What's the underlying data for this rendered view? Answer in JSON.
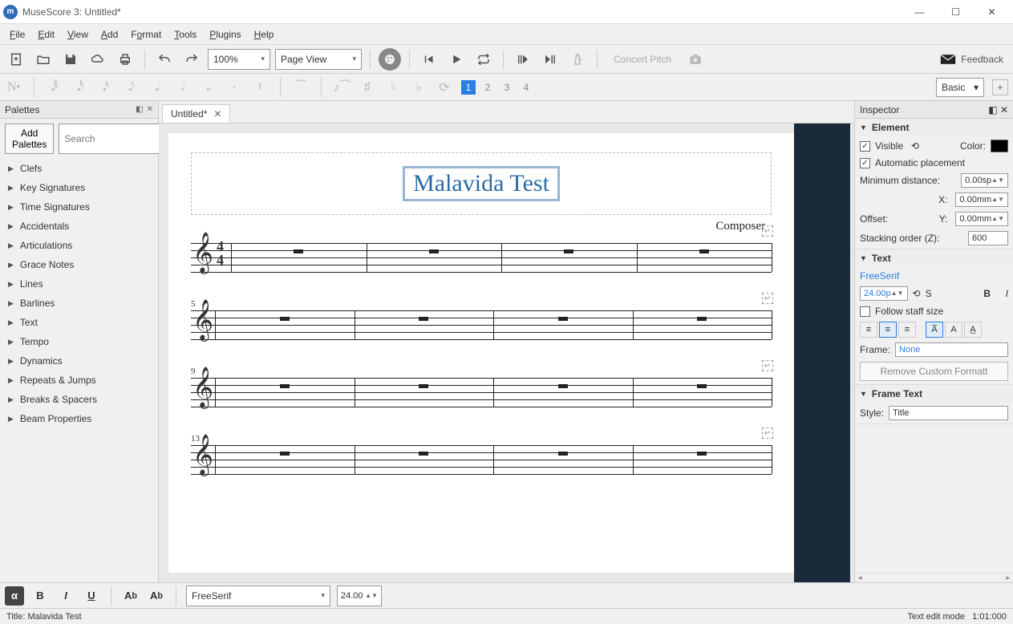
{
  "window": {
    "title": "MuseScore 3: Untitled*"
  },
  "menu": [
    "File",
    "Edit",
    "View",
    "Add",
    "Format",
    "Tools",
    "Plugins",
    "Help"
  ],
  "toolbar": {
    "zoom": "100%",
    "viewmode": "Page View",
    "concert_pitch": "Concert Pitch",
    "feedback": "Feedback"
  },
  "toolbar2": {
    "voices": [
      "1",
      "2",
      "3",
      "4"
    ],
    "workspace": "Basic"
  },
  "palettes": {
    "title": "Palettes",
    "add": "Add Palettes",
    "search_ph": "Search",
    "items": [
      "Clefs",
      "Key Signatures",
      "Time Signatures",
      "Accidentals",
      "Articulations",
      "Grace Notes",
      "Lines",
      "Barlines",
      "Text",
      "Tempo",
      "Dynamics",
      "Repeats & Jumps",
      "Breaks & Spacers",
      "Beam Properties"
    ]
  },
  "tab": {
    "label": "Untitled*"
  },
  "score": {
    "title": "Malavida Test",
    "composer": "Composer",
    "timesig_top": "4",
    "timesig_bot": "4",
    "systems": [
      {
        "bar_label": ""
      },
      {
        "bar_label": "5"
      },
      {
        "bar_label": "9"
      },
      {
        "bar_label": "13"
      }
    ]
  },
  "inspector": {
    "title": "Inspector",
    "element": {
      "section": "Element",
      "visible": "Visible",
      "color": "Color:",
      "autoplace": "Automatic placement",
      "mindist_lbl": "Minimum distance:",
      "mindist": "0.00sp",
      "offset": "Offset:",
      "x_lbl": "X:",
      "x": "0.00mm",
      "y_lbl": "Y:",
      "y": "0.00mm",
      "stack_lbl": "Stacking order (Z):",
      "stack": "600"
    },
    "text": {
      "section": "Text",
      "font": "FreeSerif",
      "size": "24.00p",
      "s": "S",
      "follow": "Follow staff size",
      "frame_lbl": "Frame:",
      "frame": "None",
      "remove": "Remove Custom Formatt"
    },
    "frametext": {
      "section": "Frame Text",
      "style_lbl": "Style:",
      "style": "Title"
    }
  },
  "bottom": {
    "font": "FreeSerif",
    "size": "24.00"
  },
  "status": {
    "left": "Title: Malavida Test",
    "mode": "Text edit mode",
    "time": "1:01:000"
  }
}
